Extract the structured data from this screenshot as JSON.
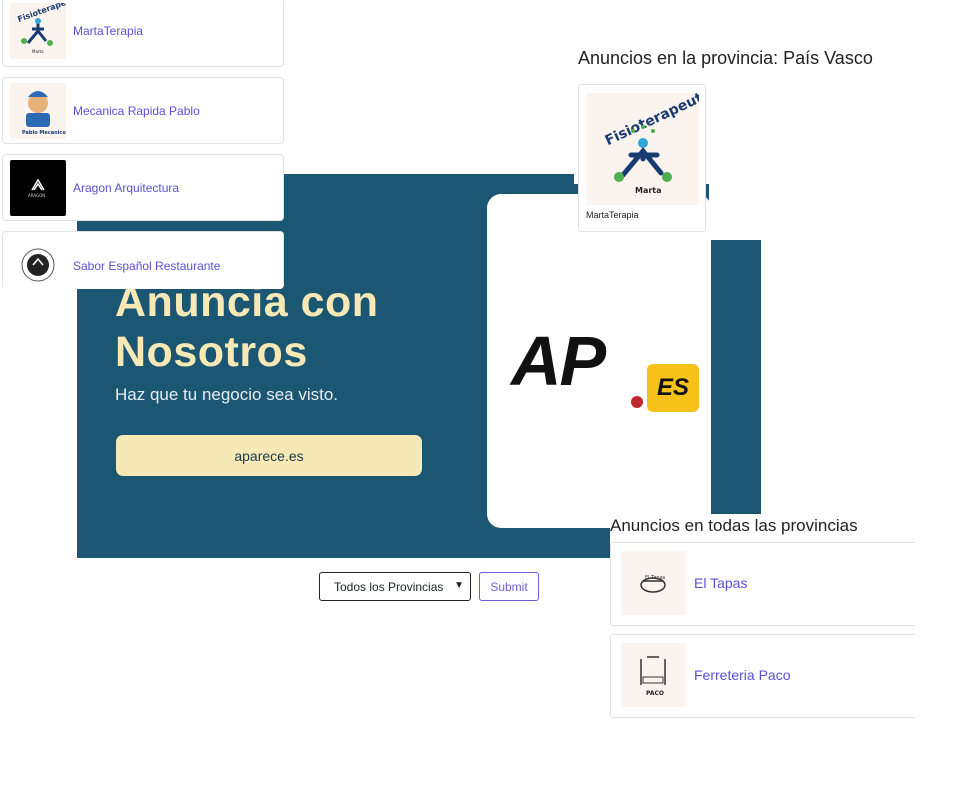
{
  "left_list": [
    {
      "name": "MartaTerapia",
      "logo_icon": "fisioterapeuta-logo-icon"
    },
    {
      "name": "Mecanica Rapida Pablo",
      "logo_icon": "mechanic-logo-icon"
    },
    {
      "name": "Aragon Arquitectura",
      "logo_icon": "aragon-logo-icon"
    },
    {
      "name": "Sabor Español Restaurante",
      "logo_icon": "restaurant-logo-icon"
    }
  ],
  "banner": {
    "headline": "Anuncia con Nosotros",
    "subline": "Haz que tu negocio sea visto.",
    "cta": "aparece.es",
    "logo_text": "AP",
    "logo_badge": "ES",
    "colors": {
      "background": "#1b5673",
      "accent": "#f7e9b5",
      "badge": "#f6c21a"
    }
  },
  "province": {
    "title": "Anuncios en la provincia: País Vasco",
    "items": [
      {
        "name": "MartaTerapia",
        "logo_icon": "fisioterapeuta-logo-icon"
      }
    ]
  },
  "form": {
    "select_value": "Todos los Provincias",
    "submit_label": "Submit"
  },
  "all_provinces": {
    "title": "Anuncios en todas las provincias",
    "items": [
      {
        "name": "El Tapas",
        "logo_icon": "el-tapas-logo-icon"
      },
      {
        "name": "Ferreteria Paco",
        "logo_icon": "ferreteria-logo-icon"
      }
    ]
  }
}
